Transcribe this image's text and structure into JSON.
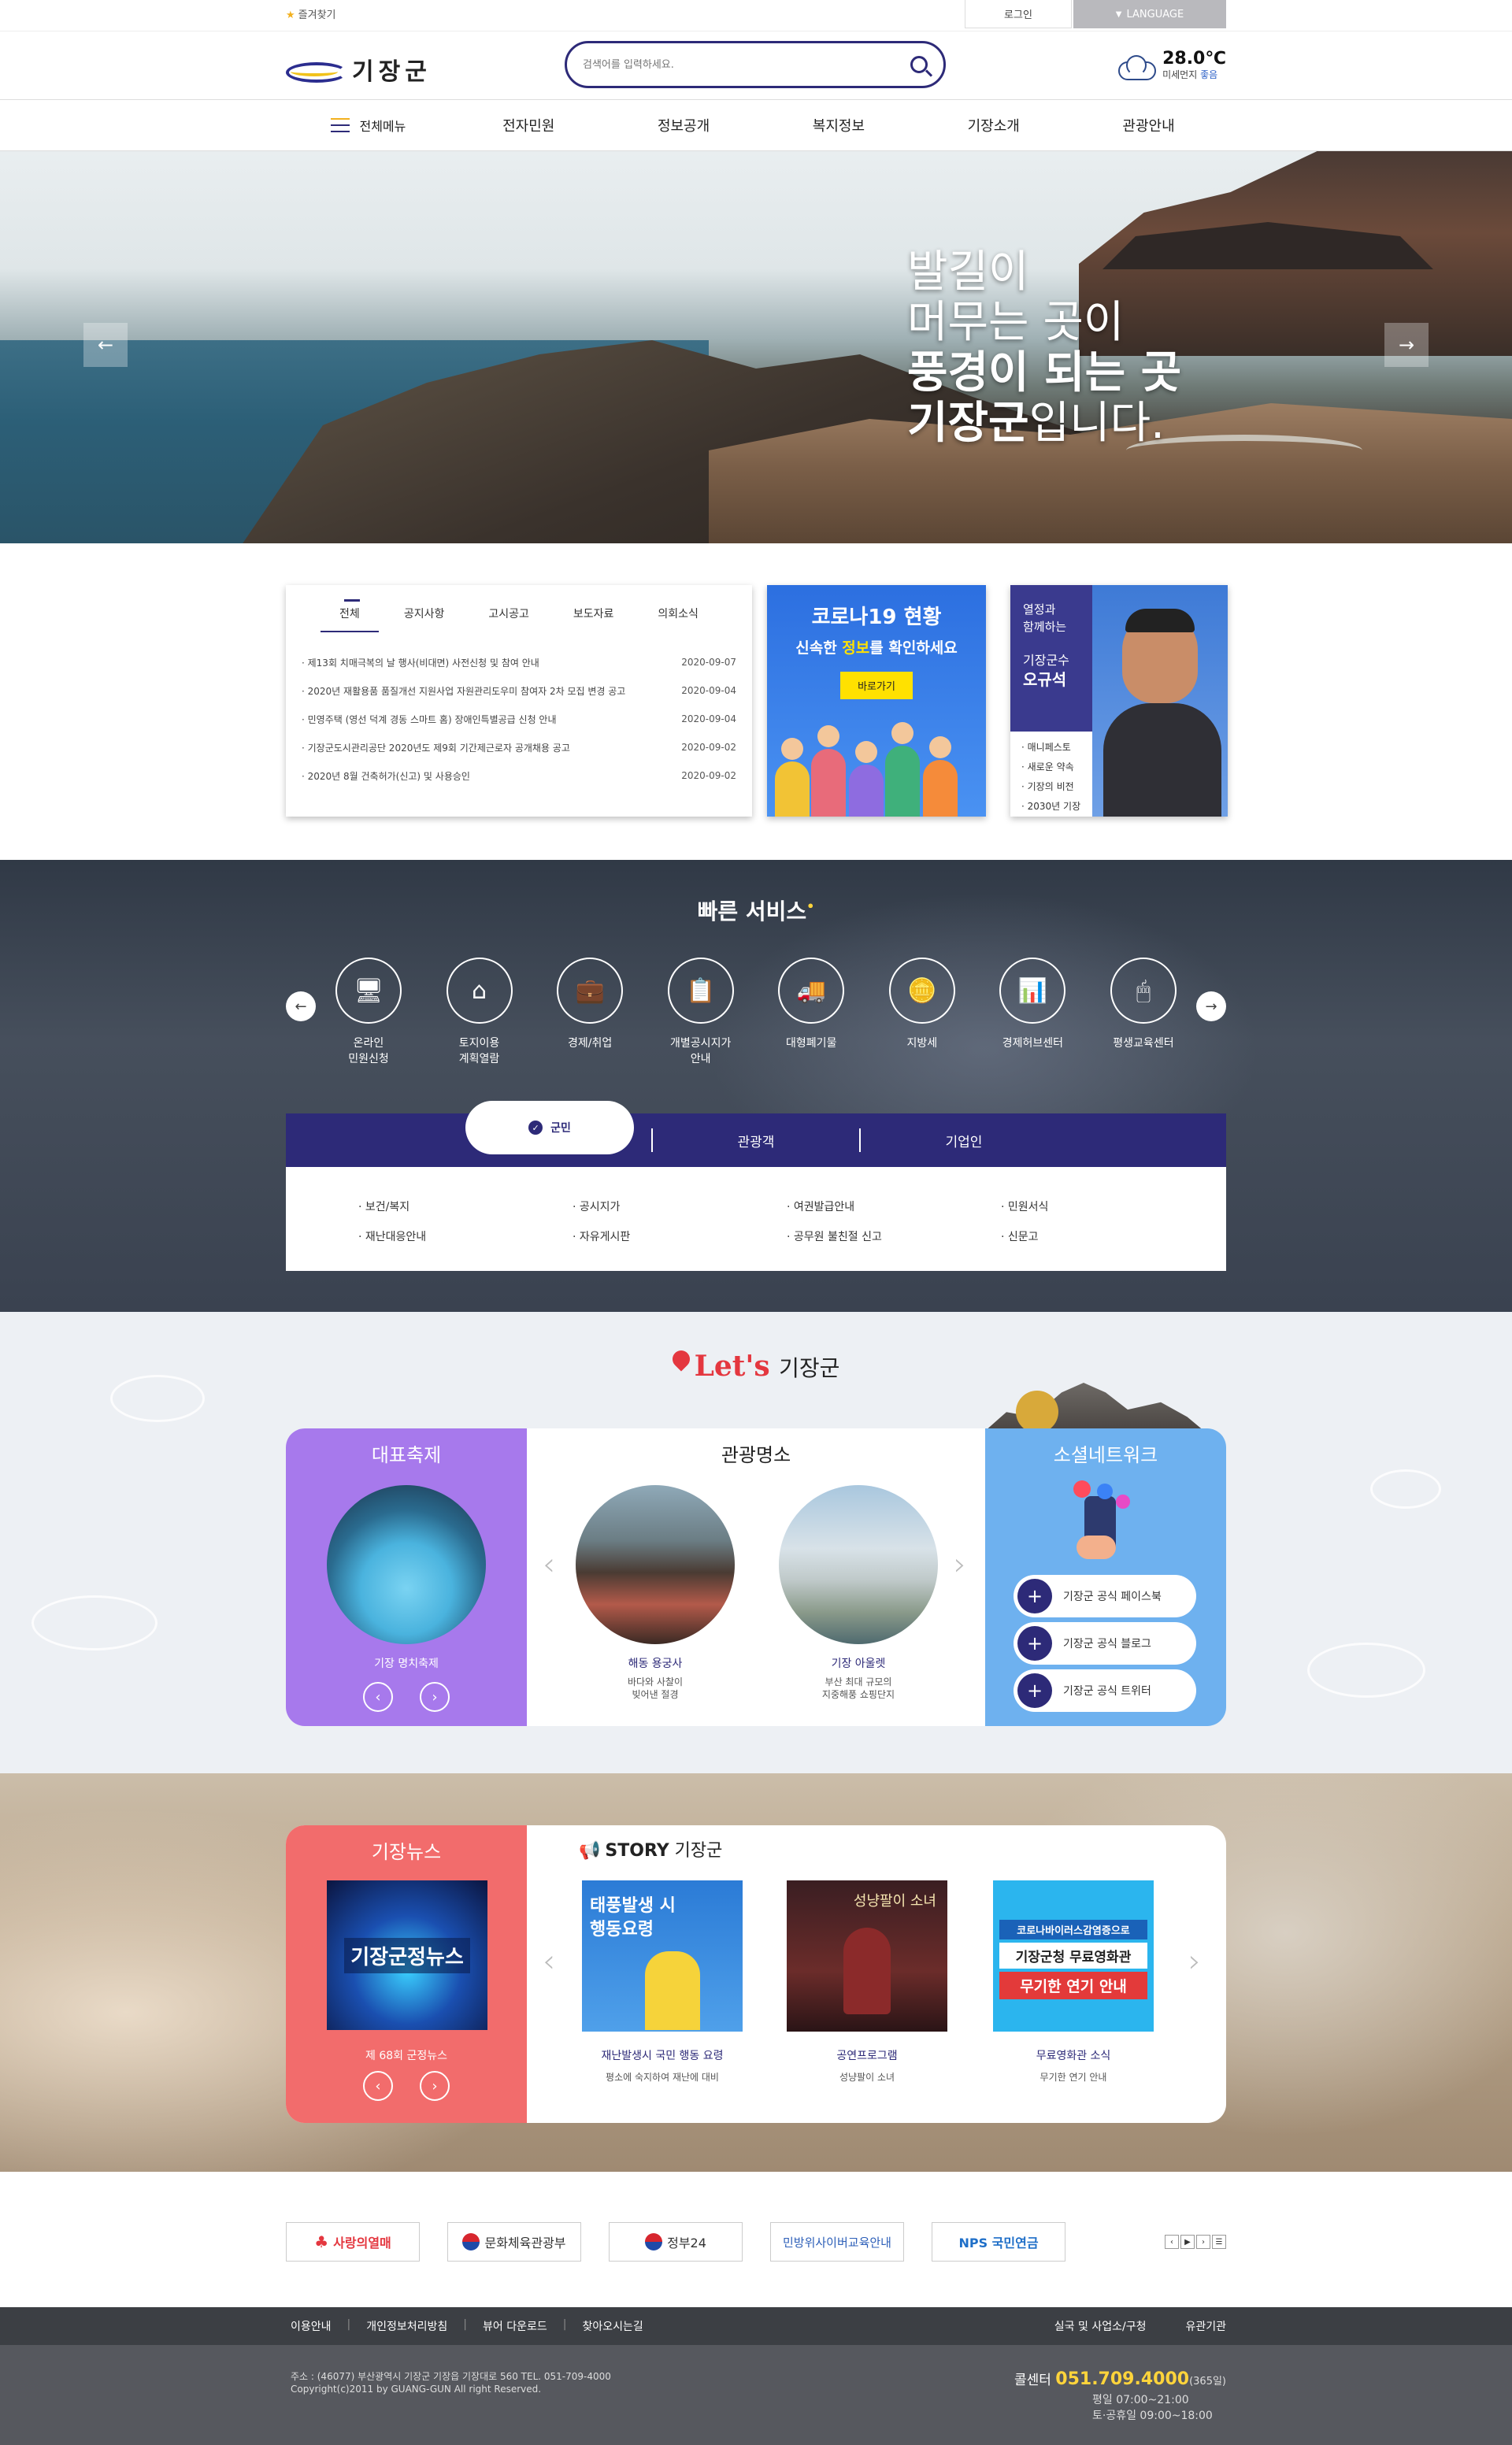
{
  "topbar": {
    "favorites": "즐겨찾기",
    "login": "로그인",
    "language": "LANGUAGE"
  },
  "header": {
    "logo_text": "기장군",
    "search_placeholder": "검색어를 입력하세요.",
    "weather": {
      "temp": "28.0℃",
      "dust_label": "미세먼지",
      "dust_value": "좋음"
    }
  },
  "gnb": {
    "all_menu": "전체메뉴",
    "items": [
      "전자민원",
      "정보공개",
      "복지정보",
      "기장소개",
      "관광안내"
    ]
  },
  "hero": {
    "lines": [
      "발길이",
      "머무는 곳이",
      "풍경이 되는 곳",
      "기장군",
      "입니다."
    ]
  },
  "notice": {
    "tabs": [
      "전체",
      "공지사항",
      "고시공고",
      "보도자료",
      "의회소식"
    ],
    "items": [
      {
        "title": "· 제13회 치매극복의 날 행사(비대면) 사전신청 및 참여 안내",
        "date": "2020-09-07"
      },
      {
        "title": "· 2020년 재활용품 품질개선 지원사업 자원관리도우미 참여자 2차 모집 변경 공고",
        "date": "2020-09-04"
      },
      {
        "title": "· 민영주택 (영선 덕계 경동 스마트 홈) 장애인특별공급 신청 안내",
        "date": "2020-09-04"
      },
      {
        "title": "· 기장군도시관리공단 2020년도 제9회 기간제근로자 공개채용 공고",
        "date": "2020-09-02"
      },
      {
        "title": "· 2020년 8월 건축허가(신고) 및 사용승인",
        "date": "2020-09-02"
      }
    ]
  },
  "covid": {
    "title": "코로나19 현황",
    "sub_pre": "신속한 ",
    "sub_hl": "정보",
    "sub_post": "를 확인하세요",
    "button": "바로가기"
  },
  "mayor": {
    "line1a": "열정과",
    "line1b": "함께하는",
    "role": "기장군수",
    "name": "오규석",
    "menu": [
      "· 매니페스토",
      "· 새로운 약속",
      "· 기장의 비전",
      "· 2030년 기장"
    ]
  },
  "quick": {
    "title": "빠른 서비스",
    "items": [
      {
        "l1": "온라인",
        "l2": "민원신청",
        "icon": "computer-icon",
        "glyph": "🖥"
      },
      {
        "l1": "토지이용",
        "l2": "계획열람",
        "icon": "land-icon",
        "glyph": "⌂"
      },
      {
        "l1": "경제/취업",
        "l2": "",
        "icon": "briefcase-icon",
        "glyph": "💼"
      },
      {
        "l1": "개별공시지가",
        "l2": "안내",
        "icon": "clipboard-icon",
        "glyph": "📋"
      },
      {
        "l1": "대형폐기물",
        "l2": "",
        "icon": "truck-icon",
        "glyph": "🚚"
      },
      {
        "l1": "지방세",
        "l2": "",
        "icon": "tax-icon",
        "glyph": "🪙"
      },
      {
        "l1": "경제허브센터",
        "l2": "",
        "icon": "presentation-icon",
        "glyph": "📊"
      },
      {
        "l1": "평생교육센터",
        "l2": "",
        "icon": "mouse-icon",
        "glyph": "🖱"
      }
    ]
  },
  "tabs": {
    "items": [
      "군민",
      "관광객",
      "기업인"
    ],
    "links": [
      "· 보건/복지",
      "· 공시지가",
      "· 여권발급안내",
      "· 민원서식",
      "· 재난대응안내",
      "· 자유게시판",
      "· 공무원 불친절 신고",
      "· 신문고"
    ]
  },
  "lets": {
    "title_a": "Let's",
    "title_b": "기장군",
    "festival": {
      "title": "대표축제",
      "caption": "기장 명치축제"
    },
    "tour": {
      "title": "관광명소",
      "items": [
        {
          "name": "해동 용궁사",
          "desc1": "바다와 사찰이",
          "desc2": "빚어낸 절경"
        },
        {
          "name": "기장 아울렛",
          "desc1": "부산 최대 규모의",
          "desc2": "지중해풍 쇼핑단지"
        }
      ]
    },
    "sns": {
      "title": "소셜네트워크",
      "items": [
        "기장군 공식 페이스북",
        "기장군 공식 블로그",
        "기장군 공식 트위터"
      ]
    }
  },
  "news": {
    "title": "기장뉴스",
    "thumb_text": "기장군정뉴스",
    "caption": "제 68회 군정뉴스",
    "story_a": "STORY",
    "story_b": "기장군",
    "stories": [
      {
        "thumb": "태풍발생 시 행동요령",
        "title": "재난발생시 국민 행동 요령",
        "desc": "평소에 숙지하여 재난에 대비"
      },
      {
        "thumb": "성냥팔이 소녀",
        "title": "공연프로그램",
        "desc": "성냥팔이 소녀"
      },
      {
        "thumb_l1": "코로나바이러스감염증으로",
        "thumb_l2": "기장군청 무료영화관",
        "thumb_l3": "무기한 연기 안내",
        "title": "무료영화관 소식",
        "desc": "무기한 연기 안내"
      }
    ]
  },
  "banners": [
    {
      "text": "사랑의열매",
      "icon": "fruit-icon"
    },
    {
      "text": "문화체육관광부",
      "icon": "taegeuk-icon"
    },
    {
      "text": "정부24",
      "icon": "taegeuk-icon"
    },
    {
      "text": "민방위사이버교육안내",
      "icon": ""
    },
    {
      "text": "NPS 국민연금",
      "icon": ""
    }
  ],
  "footer": {
    "links": [
      "이용안내",
      "개인정보처리방침",
      "뷰어 다운로드",
      "찾아오시는길"
    ],
    "right": [
      "실국 및 사업소/구청",
      "유관기관"
    ],
    "addr1": "주소 : (46077) 부산광역시 기장군 기장읍 기장대로 560 TEL. 051-709-4000",
    "addr2": "Copyright(c)2011 by GUANG-GUN All right Reserved.",
    "call_label": "콜센터",
    "call_num": "051.709.4000",
    "call_note": "(365일)",
    "hours1": "평일 07:00~21:00",
    "hours2": "토·공휴일 09:00~18:00"
  },
  "colors": {
    "primary": "#2d2a78",
    "festival": "#a779ec",
    "sns": "#6eb1ef",
    "news": "#f26c6c",
    "covid": "#2c6fe0"
  }
}
